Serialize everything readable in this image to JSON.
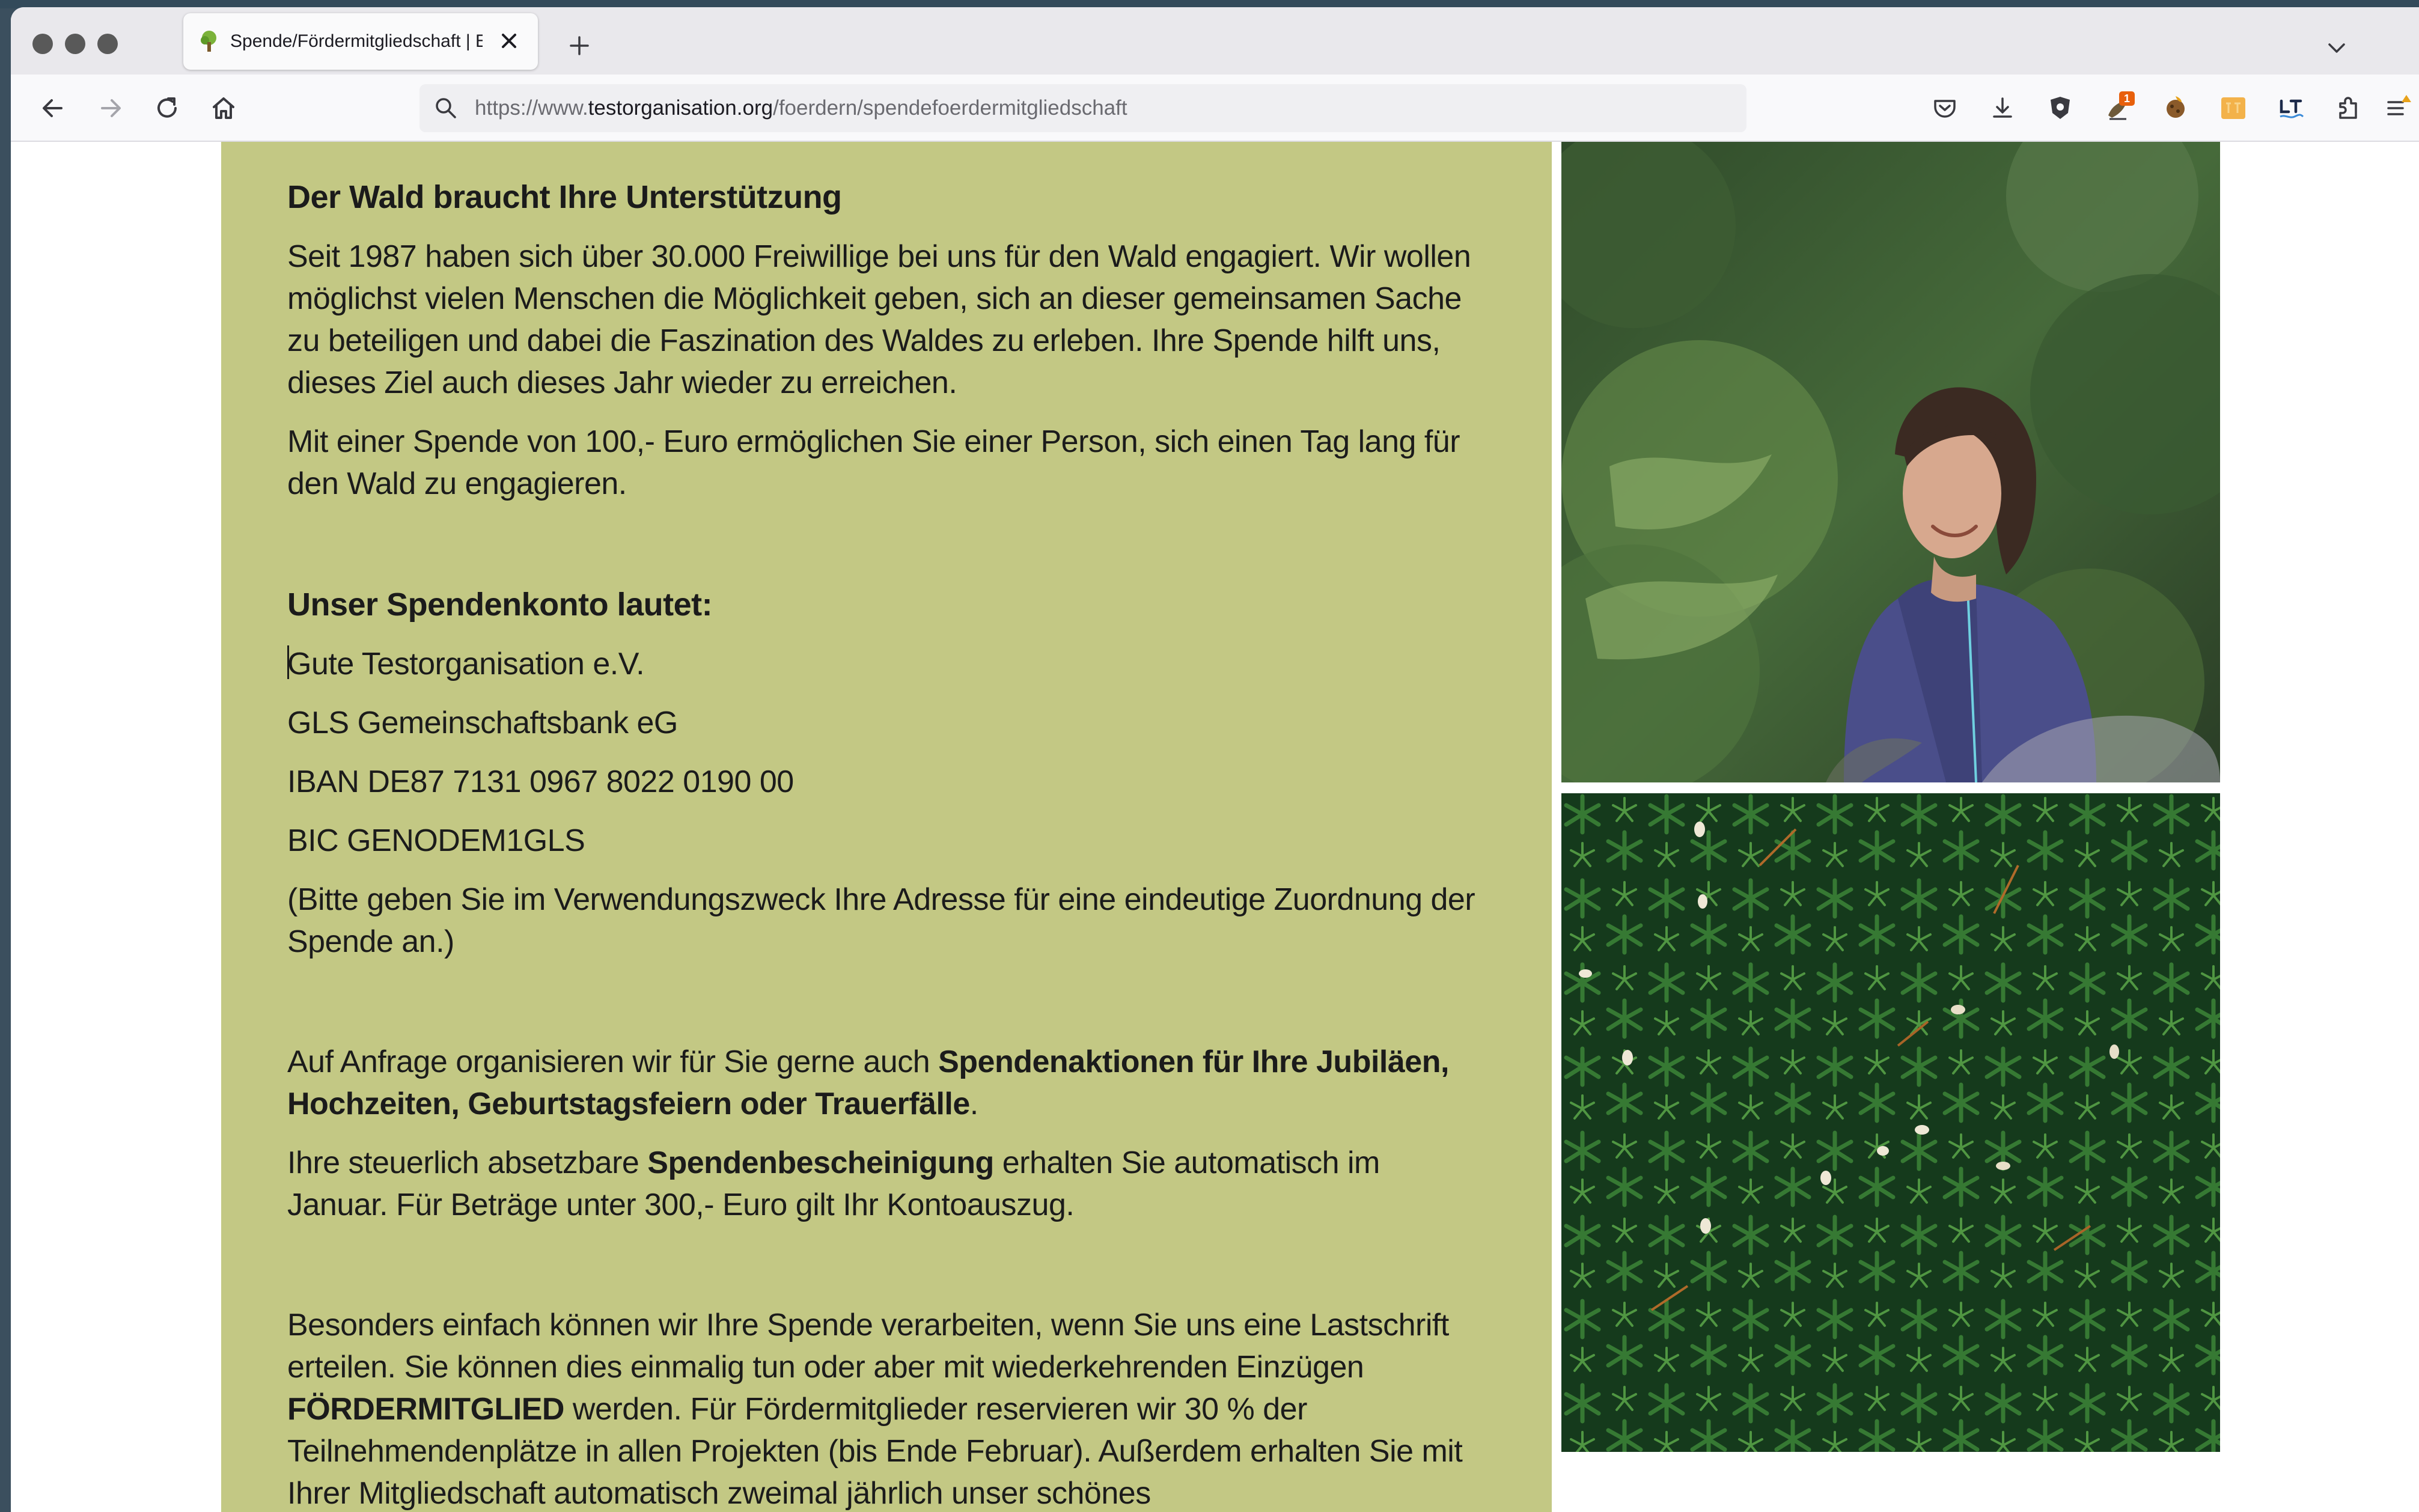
{
  "browser": {
    "tab": {
      "title": "Spende/Fördermitgliedschaft | E"
    },
    "url": {
      "prefix": "https://www.",
      "host": "testorganisation.org",
      "path": "/foerdern/spendefoerdermitgliedschaft"
    },
    "toolbar": {
      "notification_badge": "1"
    }
  },
  "page": {
    "section1": {
      "heading": "Der Wald braucht Ihre Unterstützung",
      "p1": "Seit 1987 haben sich über 30.000 Freiwillige bei uns für den Wald engagiert. Wir wollen möglichst vielen Menschen die Möglichkeit geben, sich an dieser gemeinsamen Sache zu beteiligen und dabei die Faszination des Waldes zu erleben. Ihre Spende hilft uns, dieses Ziel auch dieses Jahr wieder zu erreichen.",
      "p2": "Mit einer Spende von 100,- Euro ermöglichen Sie einer Person, sich einen Tag lang für den Wald zu engagieren."
    },
    "account": {
      "heading": "Unser Spendenkonto lautet:",
      "holder": "Gute Testorganisation e.V.",
      "bank": "GLS Gemeinschaftsbank eG",
      "iban": "IBAN DE87 7131 0967 8022 0190 00",
      "bic": "BIC GENODEM1GLS",
      "note": "(Bitte geben Sie im Verwendungszweck Ihre Adresse für eine eindeutige Zuordnung der Spende an.)"
    },
    "section3": {
      "p1_text": "Auf Anfrage organisieren wir für Sie gerne auch ",
      "p1_bold": "Spendenaktionen für Ihre Jubiläen, Hochzeiten, Geburtstagsfeiern oder Trauerfälle",
      "p1_end": ".",
      "p2_text": "Ihre steuerlich absetzbare ",
      "p2_bold": "Spendenbescheinigung",
      "p2_end": " erhalten Sie automatisch im Januar. Für Beträge unter 300,- Euro gilt Ihr Kontoauszug."
    },
    "section4": {
      "p1_text": "Besonders einfach können wir Ihre Spende verarbeiten, wenn Sie uns eine Lastschrift erteilen. Sie können dies einmalig tun oder aber mit wiederkehrenden Einzügen ",
      "p1_bold": "FÖRDERMITGLIED",
      "p1_end": " werden. Für Fördermitglieder reservieren wir 30 % der Teilnehmendenplätze in allen Projekten (bis Ende Februar). Außerdem erhalten Sie mit Ihrer Mitgliedschaft automatisch zweimal jährlich unser schönes"
    }
  },
  "colors": {
    "content_background": "#c3c884",
    "text": "#1b1b1b",
    "tabstrip": "#e9e8ec",
    "navbar": "#f9f9fb"
  },
  "icons": {
    "tab_favicon": "tree-icon",
    "tab_close": "close-icon",
    "new_tab": "plus-icon",
    "tabs_menu": "chevron-down-icon",
    "back": "arrow-left-icon",
    "forward": "arrow-right-icon",
    "reload": "reload-icon",
    "home": "home-icon",
    "url_search": "search-icon",
    "pocket": "pocket-icon",
    "downloads": "download-icon",
    "shield": "shield-icon",
    "extensions": "puzzle-icon",
    "menu": "hamburger-menu-icon"
  }
}
